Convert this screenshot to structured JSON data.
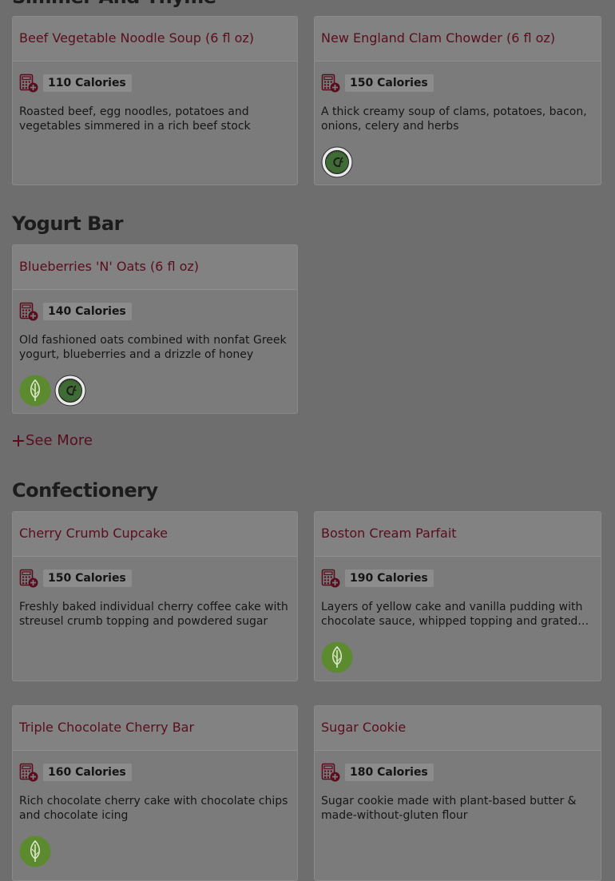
{
  "sections": [
    {
      "title": "Simmer And Thyme",
      "items": [
        {
          "name": "Beef Vegetable Noodle Soup (6 fl oz)",
          "calories": "110 Calories",
          "description": "Roasted beef, egg noodles, potatoes and vegetables simmered in a rich beef stock",
          "badges": []
        },
        {
          "name": "New England Clam Chowder (6 fl oz)",
          "calories": "150 Calories",
          "description": "A thick creamy soup of clams, potatoes, bacon, onions, celery and herbs",
          "badges": [
            "low-carbon-icon"
          ]
        }
      ]
    },
    {
      "title": "Yogurt Bar",
      "items": [
        {
          "name": "Blueberries 'N' Oats (6 fl oz)",
          "calories": "140 Calories",
          "description": "Old fashioned oats combined with nonfat Greek yogurt, blueberries and a drizzle of honey",
          "badges": [
            "vegetarian-icon",
            "low-carbon-icon"
          ]
        }
      ],
      "see_more": "See More"
    },
    {
      "title": "Confectionery",
      "items": [
        {
          "name": "Cherry Crumb Cupcake",
          "calories": "150 Calories",
          "description": "Freshly baked individual cherry coffee cake with streusel crumb topping and powdered sugar",
          "badges": []
        },
        {
          "name": "Boston Cream Parfait",
          "calories": "190 Calories",
          "description": "Layers of yellow cake and vanilla pudding with chocolate sauce, whipped topping and grated chocolate",
          "badges": [
            "vegetarian-icon"
          ]
        },
        {
          "name": "Triple Chocolate Cherry Bar",
          "calories": "160 Calories",
          "description": "Rich chocolate cherry cake with chocolate chips and chocolate icing",
          "badges": [
            "vegetarian-icon"
          ]
        },
        {
          "name": "Sugar Cookie",
          "calories": "180 Calories",
          "description": "Sugar cookie made with plant-based butter & made-without-gluten flour",
          "badges": []
        }
      ]
    }
  ],
  "icons": {
    "nutrition": "nutrition-calculator-icon",
    "plus": "plus-icon"
  },
  "colors": {
    "item_link": "#5a0d1f",
    "vegetarian_badge": "#5c8a2e",
    "low_carbon_badge": "#3f6b35"
  }
}
